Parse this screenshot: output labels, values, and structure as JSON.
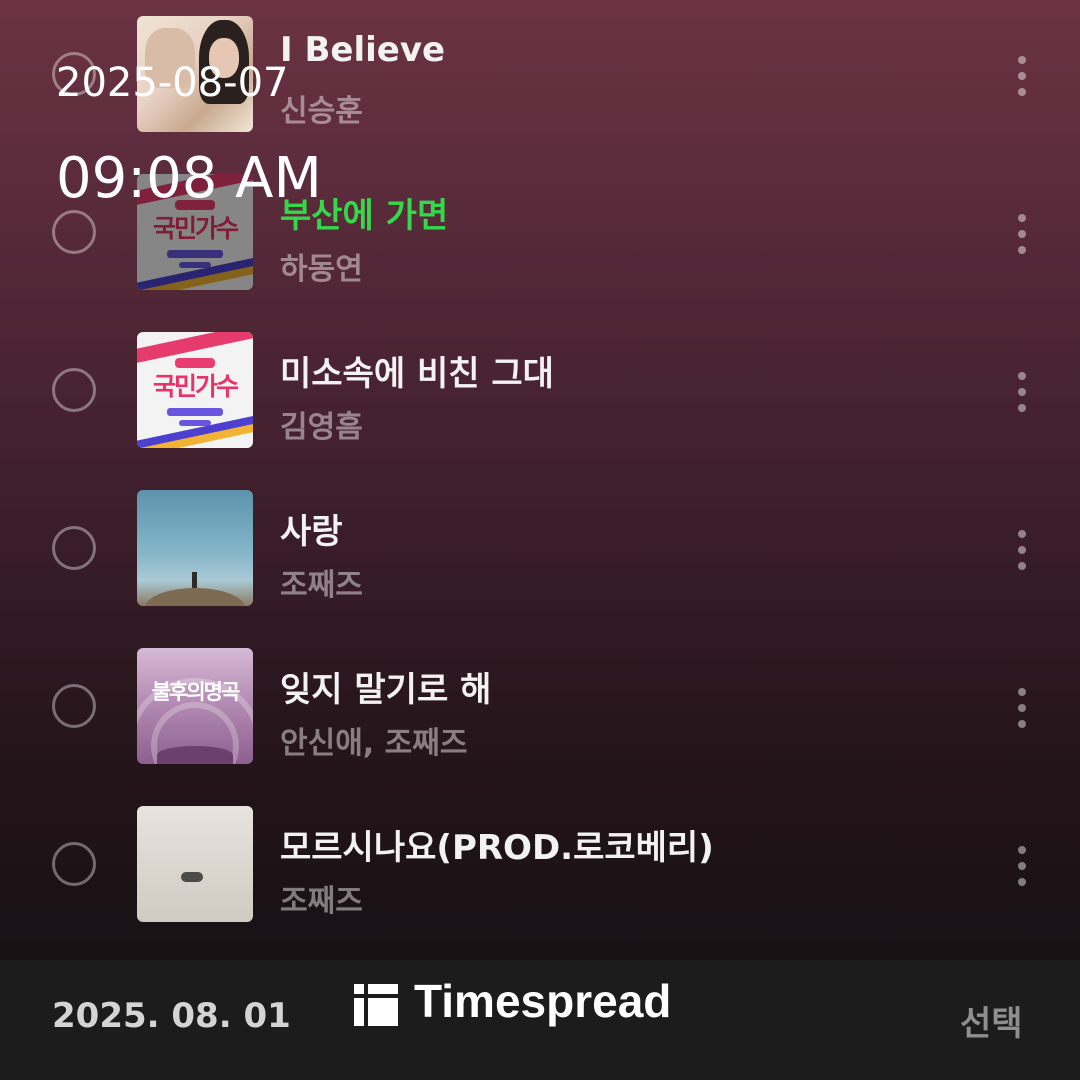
{
  "overlay": {
    "date": "2025-08-07",
    "time": "09:08 AM"
  },
  "songs": [
    {
      "title": "I Believe",
      "artist": "신승훈",
      "playing": false,
      "art": "art-a"
    },
    {
      "title": "부산에 가면",
      "artist": "하동연",
      "playing": true,
      "art": "art-b-dim"
    },
    {
      "title": "미소속에 비친 그대",
      "artist": "김영흠",
      "playing": false,
      "art": "art-b"
    },
    {
      "title": "사랑",
      "artist": "조째즈",
      "playing": false,
      "art": "art-c"
    },
    {
      "title": "잊지 말기로 해",
      "artist": "안신애, 조째즈",
      "playing": false,
      "art": "art-d"
    },
    {
      "title": "모르시나요(PROD.로코베리)",
      "artist": "조째즈",
      "playing": false,
      "art": "art-e"
    }
  ],
  "art_text": {
    "kukmin": "국민가수",
    "bulhu": "불후의명곡"
  },
  "bottom_bar": {
    "date": "2025. 08. 01",
    "logo": "Timespread",
    "select_label": "선택"
  },
  "colors": {
    "playing": "#35d84a",
    "bar_bg": "#1d1c1d",
    "gradient_top": "#6b3344"
  }
}
